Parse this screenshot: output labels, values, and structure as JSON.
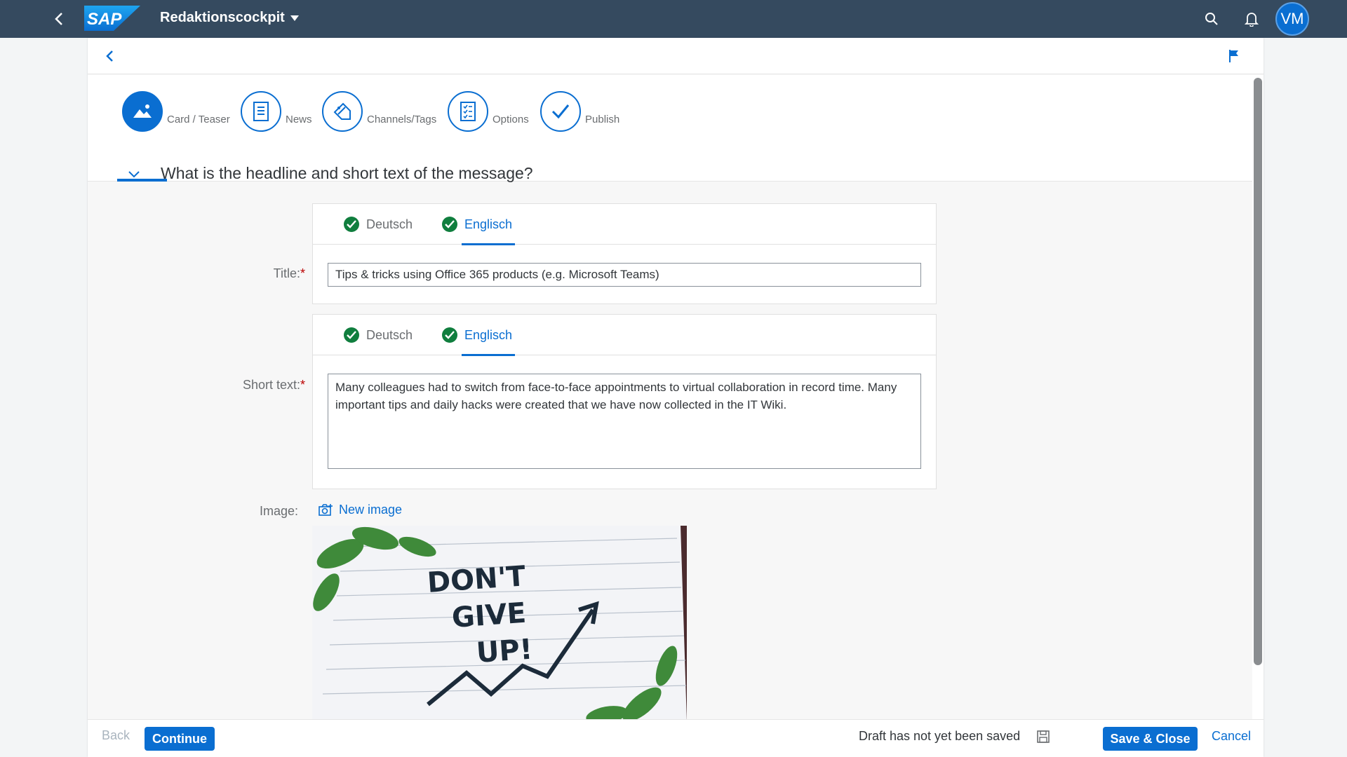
{
  "shell": {
    "app_title": "Redaktionscockpit",
    "logo_text": "SAP",
    "avatar_initials": "VM",
    "icons": [
      "back-icon",
      "search-icon",
      "bell-icon"
    ]
  },
  "wizard": {
    "steps": [
      {
        "label": "Card / Teaser",
        "icon": "mountain-icon",
        "active": true
      },
      {
        "label": "News",
        "icon": "document-icon",
        "active": false
      },
      {
        "label": "Channels/Tags",
        "icon": "tag-icon",
        "active": false
      },
      {
        "label": "Options",
        "icon": "checklist-icon",
        "active": false
      },
      {
        "label": "Publish",
        "icon": "checkmark-icon",
        "active": false
      }
    ]
  },
  "section": {
    "title": "What is the headline and short text of the message?"
  },
  "title_field": {
    "label": "Title:",
    "required_mark": "*",
    "tabs": [
      {
        "label": "Deutsch",
        "selected": false,
        "complete": true
      },
      {
        "label": "Englisch",
        "selected": true,
        "complete": true
      }
    ],
    "value": "Tips & tricks using Office 365 products (e.g. Microsoft Teams)"
  },
  "short_text_field": {
    "label": "Short text:",
    "required_mark": "*",
    "tabs": [
      {
        "label": "Deutsch",
        "selected": false,
        "complete": true
      },
      {
        "label": "Englisch",
        "selected": true,
        "complete": true
      }
    ],
    "value": "Many colleagues had to switch from face-to-face appointments to virtual collaboration in record time. Many important tips and daily hacks were created that we have now collected in the IT Wiki."
  },
  "image_field": {
    "label": "Image:",
    "new_image_label": "New image",
    "image_text": [
      "DON'T",
      "GIVE",
      "UP!"
    ]
  },
  "footer": {
    "back_label": "Back",
    "continue_label": "Continue",
    "draft_status": "Draft has not yet been saved",
    "save_close_label": "Save & Close",
    "cancel_label": "Cancel"
  },
  "colors": {
    "shell": "#354a5f",
    "accent": "#0a6ed1",
    "success": "#107e3e",
    "required": "#bb0000"
  }
}
